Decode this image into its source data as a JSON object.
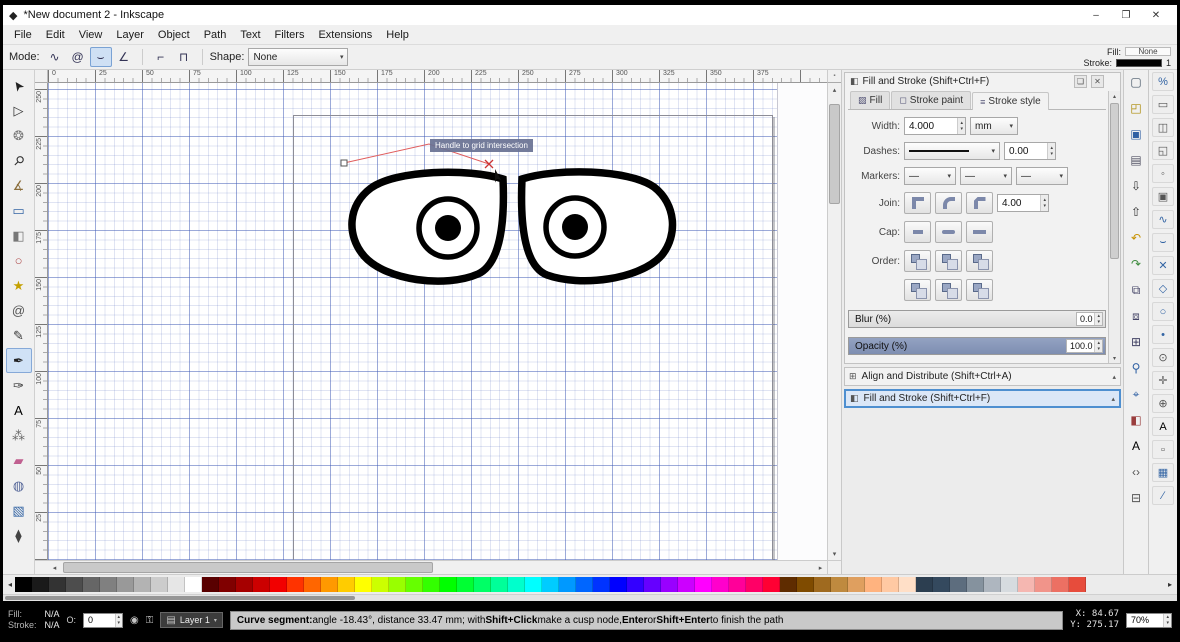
{
  "window": {
    "title": "*New document 2 - Inkscape",
    "controls": [
      {
        "name": "minimize-button",
        "glyph": "–"
      },
      {
        "name": "maximize-button",
        "glyph": "❐"
      },
      {
        "name": "close-button",
        "glyph": "✕"
      }
    ]
  },
  "menu": {
    "items": [
      "File",
      "Edit",
      "View",
      "Layer",
      "Object",
      "Path",
      "Text",
      "Filters",
      "Extensions",
      "Help"
    ]
  },
  "toolbar": {
    "mode_label": "Mode:",
    "modes": [
      {
        "name": "mode-bezier",
        "glyph": "∿",
        "active": false
      },
      {
        "name": "mode-spiro",
        "glyph": "@",
        "active": false
      },
      {
        "name": "mode-bspline",
        "glyph": "⌣",
        "active": true
      },
      {
        "name": "mode-polyline",
        "glyph": "∠",
        "active": false
      }
    ],
    "extra_buttons": [
      {
        "name": "mode-paraxial",
        "glyph": "⌐",
        "active": false
      },
      {
        "name": "mode-sequence",
        "glyph": "⊓",
        "active": false
      }
    ],
    "shape_label": "Shape:",
    "shape_value": "None",
    "fill_label": "Fill:",
    "fill_value": "None",
    "stroke_label": "Stroke:",
    "stroke_color": "#000000",
    "stroke_width_value": "1"
  },
  "tools": [
    {
      "name": "selector-tool",
      "glyph": "➤",
      "rotate": -125,
      "color": "#222",
      "active": false
    },
    {
      "name": "node-tool",
      "glyph": "▷",
      "color": "#333",
      "active": false
    },
    {
      "name": "tweak-tool",
      "glyph": "❂",
      "color": "#777",
      "active": false
    },
    {
      "name": "zoom-tool",
      "glyph": "⚲",
      "rotate": 45,
      "color": "#333",
      "active": false
    },
    {
      "name": "measure-tool",
      "glyph": "∡",
      "color": "#8a6d3b",
      "active": false
    },
    {
      "name": "rectangle-tool",
      "glyph": "▭",
      "color": "#3465a4",
      "active": false
    },
    {
      "name": "box3d-tool",
      "glyph": "◧",
      "color": "#777",
      "active": false
    },
    {
      "name": "ellipse-tool",
      "glyph": "○",
      "color": "#b05050",
      "active": false
    },
    {
      "name": "star-tool",
      "glyph": "★",
      "color": "#c4a000",
      "active": false
    },
    {
      "name": "spiral-tool",
      "glyph": "@",
      "color": "#555",
      "active": false
    },
    {
      "name": "pencil-tool",
      "glyph": "✎",
      "color": "#333",
      "active": false
    },
    {
      "name": "bezier-pen-tool",
      "glyph": "✒",
      "color": "#222",
      "active": true
    },
    {
      "name": "calligraphy-tool",
      "glyph": "✑",
      "color": "#333",
      "active": false
    },
    {
      "name": "text-tool",
      "glyph": "A",
      "color": "#000",
      "active": false
    },
    {
      "name": "spray-tool",
      "glyph": "⁂",
      "color": "#666",
      "active": false
    },
    {
      "name": "eraser-tool",
      "glyph": "▰",
      "color": "#c06090",
      "active": false
    },
    {
      "name": "bucket-fill-tool",
      "glyph": "◍",
      "color": "#556699",
      "active": false
    },
    {
      "name": "gradient-tool",
      "glyph": "▧",
      "color": "#3465a4",
      "active": false
    },
    {
      "name": "dropper-tool",
      "glyph": "⧫",
      "color": "#444",
      "active": false
    }
  ],
  "rulers": {
    "h_labels": [
      "0",
      "25",
      "50",
      "75",
      "100",
      "125",
      "150",
      "175",
      "200",
      "225",
      "250",
      "275",
      "300",
      "325",
      "350",
      "375"
    ],
    "v_labels": [
      "250",
      "225",
      "200",
      "175",
      "150",
      "125",
      "100",
      "75",
      "50",
      "25"
    ]
  },
  "canvas": {
    "tooltip": "Handle to grid intersection"
  },
  "dock": {
    "fill_stroke": {
      "title": "Fill and Stroke (Shift+Ctrl+F)",
      "tabs": [
        {
          "label": "Fill",
          "glyph": "▨",
          "active": false
        },
        {
          "label": "Stroke paint",
          "glyph": "◻",
          "active": false
        },
        {
          "label": "Stroke style",
          "glyph": "≡",
          "active": true
        }
      ],
      "width_label": "Width:",
      "width_value": "4.000",
      "width_unit": "mm",
      "dashes_label": "Dashes:",
      "dash_offset_value": "0.00",
      "markers_label": "Markers:",
      "marker_values": [
        "—",
        "—",
        "—"
      ],
      "join_label": "Join:",
      "miter_limit_value": "4.00",
      "cap_label": "Cap:",
      "order_label": "Order:",
      "blur_label": "Blur (%)",
      "blur_value": "0.0",
      "opacity_label": "Opacity (%)",
      "opacity_value": "100.0"
    },
    "panels": [
      {
        "title": "Align and Distribute (Shift+Ctrl+A)"
      },
      {
        "title": "Fill and Stroke (Shift+Ctrl+F)"
      }
    ]
  },
  "cmdbar": [
    {
      "name": "new-document-button",
      "glyph": "▢",
      "color": "#445566"
    },
    {
      "name": "open-document-button",
      "glyph": "◰",
      "color": "#aa8800"
    },
    {
      "name": "save-document-button",
      "glyph": "▣",
      "color": "#2e5fa3"
    },
    {
      "name": "print-document-button",
      "glyph": "▤",
      "color": "#556"
    },
    {
      "name": "import-button",
      "glyph": "⇩",
      "color": "#333"
    },
    {
      "name": "export-button",
      "glyph": "⇧",
      "color": "#333"
    },
    {
      "name": "undo-button",
      "glyph": "↶",
      "color": "#c79100"
    },
    {
      "name": "redo-button",
      "glyph": "↷",
      "color": "#3d8b3d"
    },
    {
      "name": "copy-button",
      "glyph": "⧉",
      "color": "#446"
    },
    {
      "name": "paste-button",
      "glyph": "⧈",
      "color": "#446"
    },
    {
      "name": "duplicate-button",
      "glyph": "⊞",
      "color": "#446"
    },
    {
      "name": "zoom-selection-button",
      "glyph": "⚲",
      "color": "#2e5fa3"
    },
    {
      "name": "zoom-page-button",
      "glyph": "⌖",
      "color": "#2e5fa3"
    },
    {
      "name": "fill-stroke-dialog-button",
      "glyph": "◧",
      "color": "#9a3d3d"
    },
    {
      "name": "text-dialog-button",
      "glyph": "A",
      "color": "#000"
    },
    {
      "name": "xml-editor-button",
      "glyph": "‹›",
      "color": "#555"
    },
    {
      "name": "align-dialog-button",
      "glyph": "⊟",
      "color": "#555"
    }
  ],
  "snapbar": [
    {
      "name": "snap-toggle-button",
      "glyph": "%",
      "color": "#3465a4"
    },
    {
      "name": "snap-bbox-button",
      "glyph": "▭",
      "color": "#555"
    },
    {
      "name": "snap-bbox-edge-button",
      "glyph": "◫",
      "color": "#555"
    },
    {
      "name": "snap-bbox-corner-button",
      "glyph": "◱",
      "color": "#555"
    },
    {
      "name": "snap-bbox-midpoint-button",
      "glyph": "◦",
      "color": "#555"
    },
    {
      "name": "snap-bbox-center-button",
      "glyph": "▣",
      "color": "#555"
    },
    {
      "name": "snap-nodes-button",
      "glyph": "∿",
      "color": "#3465a4"
    },
    {
      "name": "snap-path-button",
      "glyph": "⌣",
      "color": "#3465a4"
    },
    {
      "name": "snap-intersection-button",
      "glyph": "✕",
      "color": "#3465a4"
    },
    {
      "name": "snap-cusp-node-button",
      "glyph": "◇",
      "color": "#3465a4"
    },
    {
      "name": "snap-smooth-node-button",
      "glyph": "○",
      "color": "#3465a4"
    },
    {
      "name": "snap-midpoint-button",
      "glyph": "•",
      "color": "#3465a4"
    },
    {
      "name": "snap-others-button",
      "glyph": "⊙",
      "color": "#555"
    },
    {
      "name": "snap-object-center-button",
      "glyph": "✛",
      "color": "#555"
    },
    {
      "name": "snap-rotation-center-button",
      "glyph": "⊕",
      "color": "#555"
    },
    {
      "name": "snap-text-baseline-button",
      "glyph": "A",
      "color": "#000"
    },
    {
      "name": "snap-page-border-button",
      "glyph": "▫",
      "color": "#555"
    },
    {
      "name": "snap-grid-button",
      "glyph": "▦",
      "color": "#3465a4"
    },
    {
      "name": "snap-guide-button",
      "glyph": "∕",
      "color": "#3465a4"
    }
  ],
  "palette": {
    "colors": [
      "#000000",
      "#1a1a1a",
      "#333333",
      "#4d4d4d",
      "#666666",
      "#808080",
      "#999999",
      "#b3b3b3",
      "#cccccc",
      "#e6e6e6",
      "#ffffff",
      "#590000",
      "#800000",
      "#a60000",
      "#cc0000",
      "#f20000",
      "#ff3300",
      "#ff6600",
      "#ff9900",
      "#ffcc00",
      "#ffff00",
      "#ccff00",
      "#99ff00",
      "#66ff00",
      "#33ff00",
      "#00ff00",
      "#00ff33",
      "#00ff66",
      "#00ff99",
      "#00ffcc",
      "#00ffff",
      "#00ccff",
      "#0099ff",
      "#0066ff",
      "#0033ff",
      "#0000ff",
      "#3300ff",
      "#6600ff",
      "#9900ff",
      "#cc00ff",
      "#ff00ff",
      "#ff00cc",
      "#ff0099",
      "#ff0066",
      "#ff0033",
      "#5f2c00",
      "#7f4b00",
      "#9f6a1f",
      "#bf8a3f",
      "#df9f5f",
      "#ffb37f",
      "#ffc9a3",
      "#ffdfc7",
      "#2c3e50",
      "#34495e",
      "#5d6d7e",
      "#85929e",
      "#aeb6bf",
      "#d6dbdf",
      "#f5b7b1",
      "#f1948a",
      "#ec7063",
      "#e74c3c"
    ]
  },
  "statusbar": {
    "fill_label": "Fill:",
    "fill_value": "N/A",
    "stroke_label": "Stroke:",
    "stroke_value": "N/A",
    "opacity_label": "O:",
    "opacity_value": "0",
    "layer_value": "Layer 1",
    "message_parts": [
      {
        "text": "Curve segment:",
        "bold": true
      },
      {
        "text": " angle -18.43°, distance 33.47 mm; with ",
        "bold": false
      },
      {
        "text": "Shift+Click",
        "bold": true
      },
      {
        "text": " make a cusp node, ",
        "bold": false
      },
      {
        "text": "Enter",
        "bold": true
      },
      {
        "text": " or ",
        "bold": false
      },
      {
        "text": "Shift+Enter",
        "bold": true
      },
      {
        "text": " to finish the path",
        "bold": false
      }
    ],
    "x_label": "X:",
    "x_value": "84.67",
    "y_label": "Y:",
    "y_value": "275.17",
    "zoom_value": "70%"
  },
  "icons": {
    "app": "◆",
    "dropdown": "▾",
    "spin_up": "▴",
    "spin_down": "▾",
    "scroll_up": "▴",
    "scroll_down": "▾",
    "scroll_left": "◂",
    "scroll_right": "▸",
    "expander": "▴",
    "dock_float": "❏",
    "dock_close": "✕",
    "layer": "▤",
    "eye": "◉",
    "lock": "⚿",
    "corner": "▪"
  }
}
